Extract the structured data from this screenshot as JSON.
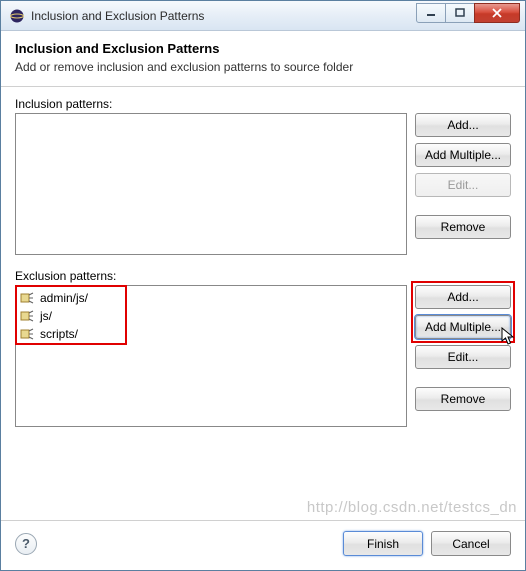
{
  "window": {
    "title": "Inclusion and Exclusion Patterns"
  },
  "header": {
    "title": "Inclusion and Exclusion Patterns",
    "description": "Add or remove inclusion and exclusion patterns to source folder"
  },
  "inclusion": {
    "label": "Inclusion patterns:",
    "items": [],
    "buttons": {
      "add": "Add...",
      "add_multiple": "Add Multiple...",
      "edit": "Edit...",
      "remove": "Remove",
      "edit_enabled": false,
      "remove_enabled": true,
      "add_enabled": true,
      "add_multiple_enabled": true
    }
  },
  "exclusion": {
    "label": "Exclusion patterns:",
    "items": [
      {
        "text": "admin/js/"
      },
      {
        "text": "js/"
      },
      {
        "text": "scripts/"
      }
    ],
    "buttons": {
      "add": "Add...",
      "add_multiple": "Add Multiple...",
      "edit": "Edit...",
      "remove": "Remove",
      "edit_enabled": true,
      "remove_enabled": true,
      "add_enabled": true,
      "add_multiple_enabled": true,
      "focused": "add_multiple"
    }
  },
  "footer": {
    "finish": "Finish",
    "cancel": "Cancel"
  },
  "watermark": "http://blog.csdn.net/testcs_dn"
}
